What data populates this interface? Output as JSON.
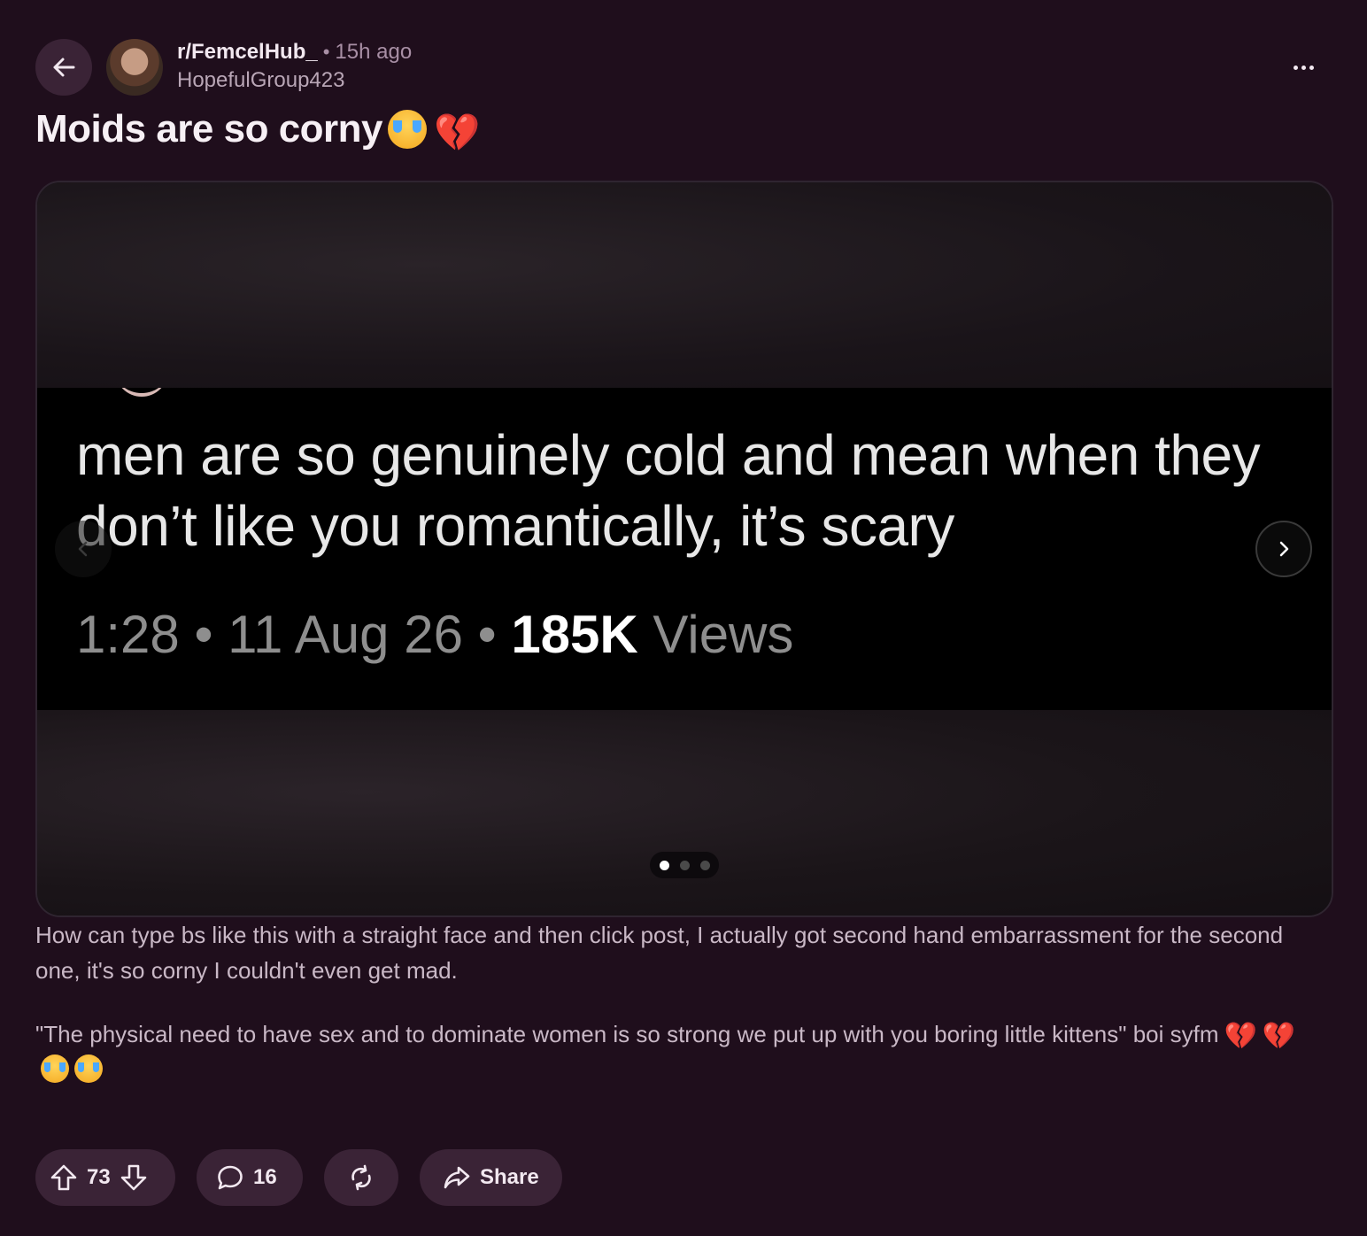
{
  "post": {
    "subreddit": "r/FemcelHub_",
    "separator": "•",
    "time": "15h ago",
    "author": "HopefulGroup423",
    "title": "Moids are so corny",
    "title_emojis": [
      "loudly-crying-face",
      "broken-heart"
    ]
  },
  "media": {
    "tweet_text": "men are so genuinely cold and mean when they don’t like you romantically, it’s scary",
    "tweet_time": "1:28",
    "tweet_sep": "•",
    "tweet_date": "11 Aug 26",
    "tweet_views_count": "185K",
    "tweet_views_label": "Views",
    "page_count": 3,
    "active_page": 1
  },
  "body": {
    "paragraph_1": "How can type bs like this with a straight face and then click post, I actually got second hand embarrassment for the second one, it's so corny I couldn't even get mad.",
    "paragraph_2": "\"The physical need to have sex and to dominate women is so strong we put up with you boring little kittens\" boi syfm",
    "paragraph_2_emojis": [
      "broken-heart",
      "broken-heart",
      "loudly-crying-face",
      "loudly-crying-face"
    ]
  },
  "actions": {
    "upvotes": "73",
    "comments": "16",
    "share_label": "Share"
  },
  "colors": {
    "background": "#1f0e1c",
    "pill": "#3a2336",
    "text": "#f2e8f0",
    "muted": "#a88fa5"
  }
}
